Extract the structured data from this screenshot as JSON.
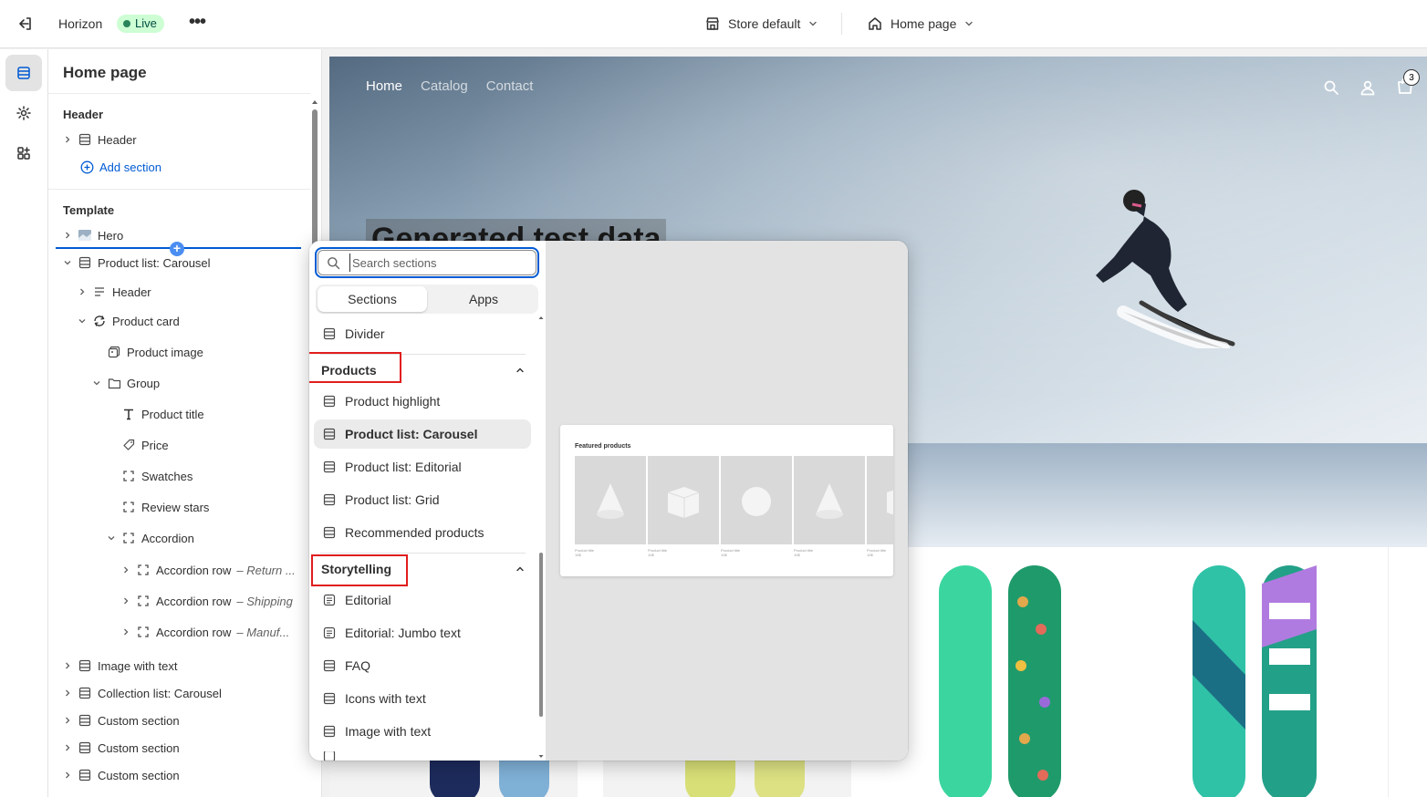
{
  "topbar": {
    "app_name": "Horizon",
    "status": "Live",
    "more_label": "•••",
    "store_selector": "Store default",
    "page_selector": "Home page"
  },
  "sidebar": {
    "title": "Home page",
    "header_group": {
      "label": "Header",
      "items": [
        {
          "label": "Header"
        }
      ],
      "add_section": "Add section"
    },
    "template_group": {
      "label": "Template",
      "hero": "Hero",
      "carousel": "Product list: Carousel",
      "header": "Header",
      "product_card": "Product card",
      "product_image": "Product image",
      "group": "Group",
      "product_title": "Product title",
      "price": "Price",
      "swatches": "Swatches",
      "review_stars": "Review stars",
      "accordion": "Accordion",
      "accordion_rows": [
        {
          "label": "Accordion row",
          "sub": "Return ..."
        },
        {
          "label": "Accordion row",
          "sub": "Shipping"
        },
        {
          "label": "Accordion row",
          "sub": "Manuf..."
        }
      ],
      "sections": [
        "Image with text",
        "Collection list: Carousel",
        "Custom section",
        "Custom section",
        "Custom section"
      ]
    }
  },
  "preview": {
    "nav": [
      "Home",
      "Catalog",
      "Contact"
    ],
    "cart_count": "3",
    "hero_heading": "Generated test data"
  },
  "picker": {
    "search_placeholder": "Search sections",
    "tabs": [
      "Sections",
      "Apps"
    ],
    "divider_item": "Divider",
    "products_category": "Products",
    "products_items": [
      "Product highlight",
      "Product list: Carousel",
      "Product list: Editorial",
      "Product list: Grid",
      "Recommended products"
    ],
    "storytelling_category": "Storytelling",
    "storytelling_items": [
      "Editorial",
      "Editorial: Jumbo text",
      "FAQ",
      "Icons with text",
      "Image with text"
    ],
    "preview_title": "Featured products",
    "preview_captions": [
      "Product title",
      "Product title",
      "Product title",
      "Product title",
      "Product title"
    ],
    "preview_prices": [
      "10$",
      "10$",
      "10$",
      "10$",
      "10$"
    ]
  },
  "colors": {
    "accent": "#005bd3",
    "live_badge_bg": "#cdfed4",
    "highlight_box": "#e11d1d"
  }
}
